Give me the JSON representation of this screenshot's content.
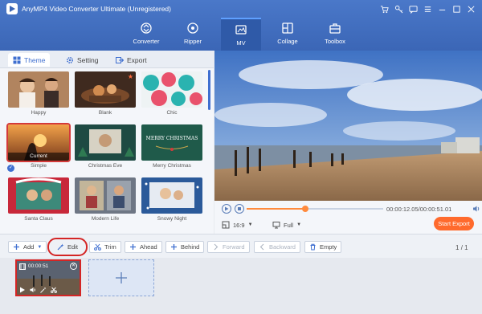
{
  "app": {
    "title": "AnyMP4 Video Converter Ultimate (Unregistered)"
  },
  "window_icons": [
    "cart-icon",
    "key-icon",
    "chat-icon",
    "menu-icon",
    "minimize-icon",
    "maximize-icon",
    "close-icon"
  ],
  "modes": [
    {
      "label": "Converter",
      "icon": "converter-icon",
      "active": false
    },
    {
      "label": "Ripper",
      "icon": "ripper-icon",
      "active": false
    },
    {
      "label": "MV",
      "icon": "mv-icon",
      "active": true
    },
    {
      "label": "Collage",
      "icon": "collage-icon",
      "active": false
    },
    {
      "label": "Toolbox",
      "icon": "toolbox-icon",
      "active": false
    }
  ],
  "tabs": [
    {
      "label": "Theme",
      "active": true
    },
    {
      "label": "Setting",
      "active": false
    },
    {
      "label": "Export",
      "active": false
    }
  ],
  "themes": [
    {
      "name": "Happy"
    },
    {
      "name": "Blank"
    },
    {
      "name": "Chic"
    },
    {
      "name": "Simple",
      "selected": true,
      "badge": "Current"
    },
    {
      "name": "Christmas Eve"
    },
    {
      "name": "Merry Christmas",
      "thumb_text": "MERRY CHRISTMAS"
    },
    {
      "name": "Santa Claus"
    },
    {
      "name": "Modern Life"
    },
    {
      "name": "Snowy Night"
    }
  ],
  "player": {
    "timecode": "00:00:12.05/00:00:51.01",
    "progress": 0.43,
    "aspect_ratio": "16:9",
    "fit_mode": "Full",
    "export_button": "Start Export"
  },
  "toolbar": {
    "add": "Add",
    "edit": "Edit",
    "trim": "Trim",
    "ahead": "Ahead",
    "behind": "Behind",
    "forward": "Forward",
    "backward": "Backward",
    "empty": "Empty",
    "page_current": "1",
    "page_sep": "/",
    "page_total": "1"
  },
  "timeline": {
    "clip_duration": "00:00:51"
  },
  "colors": {
    "header": "#3b66b6",
    "accent": "#3f6fd0",
    "export": "#ff6a2d",
    "highlight": "#d42525"
  }
}
